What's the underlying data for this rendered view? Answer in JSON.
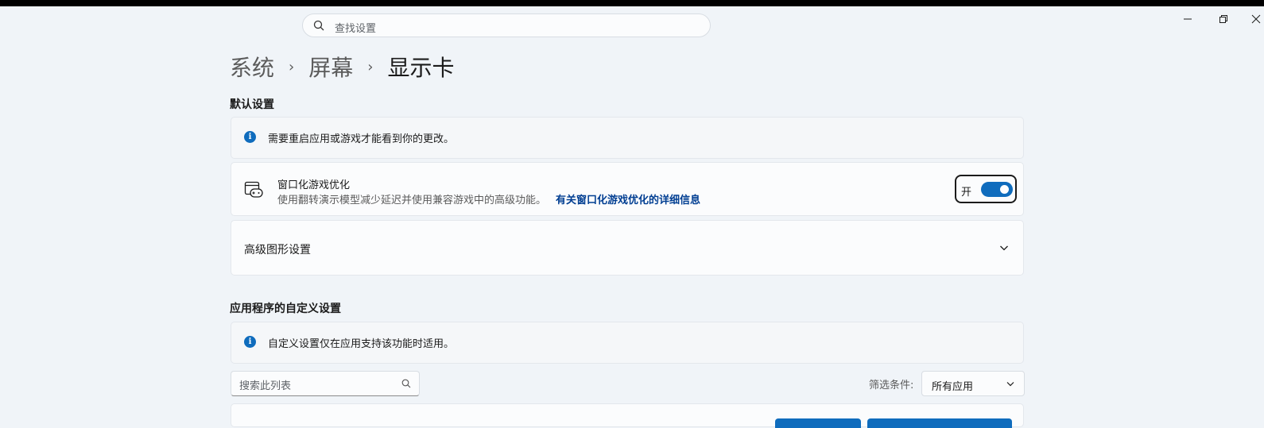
{
  "search": {
    "placeholder": "查找设置"
  },
  "window_controls": {
    "minimize": "minimize-icon",
    "restore": "restore-icon",
    "close": "close-icon"
  },
  "breadcrumb": {
    "items": [
      "系统",
      "屏幕",
      "显示卡"
    ],
    "separator": "›"
  },
  "default_section": {
    "title": "默认设置",
    "info_text": "需要重启应用或游戏才能看到你的更改。",
    "windowed_game": {
      "title": "窗口化游戏优化",
      "description": "使用翻转演示模型减少延迟并使用兼容游戏中的高级功能。",
      "link": "有关窗口化游戏优化的详细信息",
      "toggle_label": "开",
      "toggle_on": true
    },
    "advanced_graphics": {
      "title": "高级图形设置"
    }
  },
  "custom_section": {
    "title": "应用程序的自定义设置",
    "info_text": "自定义设置仅在应用支持该功能时适用。",
    "list_search_placeholder": "搜索此列表",
    "filter_label": "筛选条件:",
    "filter_value": "所有应用"
  },
  "colors": {
    "accent": "#0f6cbd",
    "link": "#003e92",
    "background": "#f0f4f8"
  }
}
